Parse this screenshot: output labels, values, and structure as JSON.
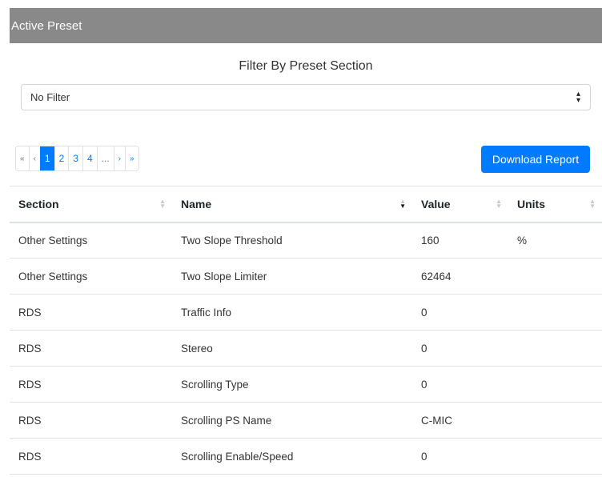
{
  "header": {
    "title": "Active Preset"
  },
  "filter": {
    "title": "Filter By Preset Section",
    "selected": "No Filter"
  },
  "pagination": {
    "first": "«",
    "prev": "‹",
    "pages": [
      "1",
      "2",
      "3",
      "4"
    ],
    "active_page": "1",
    "ellipsis": "...",
    "next": "›",
    "last": "»"
  },
  "download_button": {
    "label": "Download Report"
  },
  "table": {
    "columns": [
      "Section",
      "Name",
      "Value",
      "Units"
    ],
    "sorted_column": "Name",
    "rows": [
      {
        "section": "Other Settings",
        "name": "Two Slope Threshold",
        "value": "160",
        "units": "%"
      },
      {
        "section": "Other Settings",
        "name": "Two Slope Limiter",
        "value": "62464",
        "units": ""
      },
      {
        "section": "RDS",
        "name": "Traffic Info",
        "value": "0",
        "units": ""
      },
      {
        "section": "RDS",
        "name": "Stereo",
        "value": "0",
        "units": ""
      },
      {
        "section": "RDS",
        "name": "Scrolling Type",
        "value": "0",
        "units": ""
      },
      {
        "section": "RDS",
        "name": "Scrolling PS Name",
        "value": "C-MIC",
        "units": ""
      },
      {
        "section": "RDS",
        "name": "Scrolling Enable/Speed",
        "value": "0",
        "units": ""
      }
    ]
  },
  "colors": {
    "header_bg": "#898989",
    "accent": "#007bff",
    "border": "#dee2e6"
  }
}
